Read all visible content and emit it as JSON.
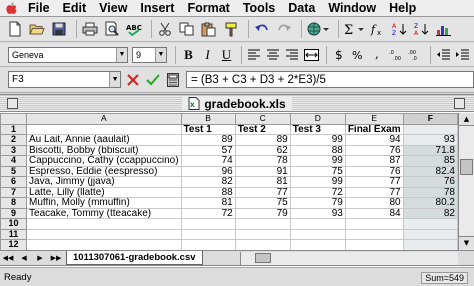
{
  "menubar": {
    "apple": "",
    "items": [
      "File",
      "Edit",
      "View",
      "Insert",
      "Format",
      "Tools",
      "Data",
      "Window",
      "Help"
    ]
  },
  "toolbar": {
    "icons": [
      "new-document",
      "open-folder",
      "save",
      "print",
      "print-preview",
      "spell-check",
      "cut",
      "copy",
      "paste",
      "format-painter",
      "undo",
      "redo",
      "web-toolbar",
      "autosum",
      "paste-function",
      "sort-ascending",
      "sort-descending",
      "chart-wizard"
    ]
  },
  "format": {
    "font": "Geneva",
    "size": "9",
    "bold": "B",
    "italic": "I",
    "underline": "U"
  },
  "formula": {
    "name_box": "F3",
    "equals": "=",
    "content": "= (B3 + C3 + D3 + 2*E3)/5"
  },
  "document": {
    "title": "gradebook.xls"
  },
  "sheet": {
    "col_headers": [
      "A",
      "B",
      "C",
      "D",
      "E",
      "F"
    ],
    "rows": [
      {
        "num": "1",
        "cells": [
          "",
          "Test 1",
          "Test 2",
          "Test 3",
          "Final Exam",
          ""
        ]
      },
      {
        "num": "2",
        "cells": [
          "Au Lait, Annie (aaulait)",
          "89",
          "89",
          "99",
          "94",
          "93"
        ]
      },
      {
        "num": "3",
        "cells": [
          "Biscotti, Bobby (bbiscuit)",
          "57",
          "62",
          "88",
          "76",
          "71.8"
        ]
      },
      {
        "num": "4",
        "cells": [
          "Cappuccino, Cathy (ccappuccino)",
          "74",
          "78",
          "99",
          "87",
          "85"
        ]
      },
      {
        "num": "5",
        "cells": [
          "Espresso, Eddie (eespresso)",
          "96",
          "91",
          "75",
          "76",
          "82.4"
        ]
      },
      {
        "num": "6",
        "cells": [
          "Java, Jimmy (jjava)",
          "82",
          "81",
          "99",
          "77",
          "76"
        ]
      },
      {
        "num": "7",
        "cells": [
          "Latte, Lilly (llatte)",
          "88",
          "77",
          "72",
          "77",
          "78"
        ]
      },
      {
        "num": "8",
        "cells": [
          "Muffin, Molly (mmuffin)",
          "81",
          "75",
          "79",
          "80",
          "80.2"
        ]
      },
      {
        "num": "9",
        "cells": [
          "Teacake, Tommy (tteacake)",
          "72",
          "79",
          "93",
          "84",
          "82"
        ]
      },
      {
        "num": "10",
        "cells": [
          "",
          "",
          "",
          "",
          "",
          ""
        ]
      },
      {
        "num": "11",
        "cells": [
          "",
          "",
          "",
          "",
          "",
          ""
        ]
      },
      {
        "num": "12",
        "cells": [
          "",
          "",
          "",
          "",
          "",
          ""
        ]
      }
    ],
    "tab_name": "1011307061-gradebook.csv"
  },
  "status": {
    "ready": "Ready",
    "sum": "Sum=549"
  },
  "colors": {
    "selection": "#d4dcdc",
    "apple_logo": "#dd3333"
  }
}
